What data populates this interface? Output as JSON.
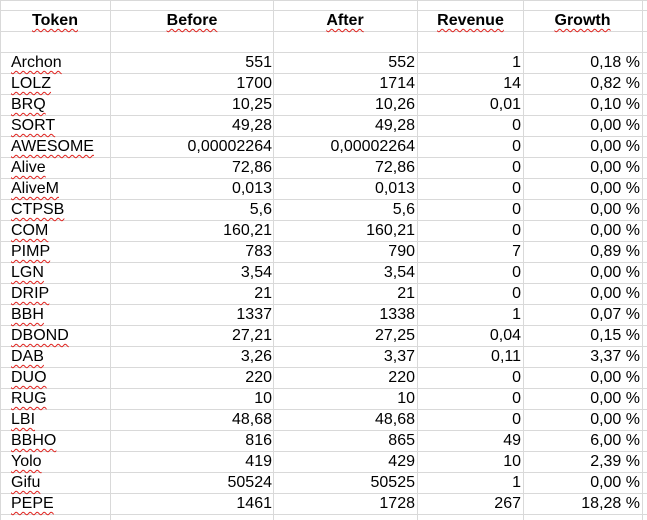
{
  "headers": {
    "token": "Token",
    "before": "Before",
    "after": "After",
    "revenue": "Revenue",
    "growth": "Growth"
  },
  "rows": [
    {
      "token": "Archon",
      "before": "551",
      "after": "552",
      "revenue": "1",
      "growth": "0,18 %"
    },
    {
      "token": "LOLZ",
      "before": "1700",
      "after": "1714",
      "revenue": "14",
      "growth": "0,82 %"
    },
    {
      "token": "BRQ",
      "before": "10,25",
      "after": "10,26",
      "revenue": "0,01",
      "growth": "0,10 %"
    },
    {
      "token": "SORT",
      "before": "49,28",
      "after": "49,28",
      "revenue": "0",
      "growth": "0,00 %"
    },
    {
      "token": "AWESOME",
      "before": "0,00002264",
      "after": "0,00002264",
      "revenue": "0",
      "growth": "0,00 %"
    },
    {
      "token": "Alive",
      "before": "72,86",
      "after": "72,86",
      "revenue": "0",
      "growth": "0,00 %"
    },
    {
      "token": "AliveM",
      "before": "0,013",
      "after": "0,013",
      "revenue": "0",
      "growth": "0,00 %"
    },
    {
      "token": "CTPSB",
      "before": "5,6",
      "after": "5,6",
      "revenue": "0",
      "growth": "0,00 %"
    },
    {
      "token": "COM",
      "before": "160,21",
      "after": "160,21",
      "revenue": "0",
      "growth": "0,00 %"
    },
    {
      "token": "PIMP",
      "before": "783",
      "after": "790",
      "revenue": "7",
      "growth": "0,89 %"
    },
    {
      "token": "LGN",
      "before": "3,54",
      "after": "3,54",
      "revenue": "0",
      "growth": "0,00 %"
    },
    {
      "token": "DRIP",
      "before": "21",
      "after": "21",
      "revenue": "0",
      "growth": "0,00 %"
    },
    {
      "token": "BBH",
      "before": "1337",
      "after": "1338",
      "revenue": "1",
      "growth": "0,07 %"
    },
    {
      "token": "DBOND",
      "before": "27,21",
      "after": "27,25",
      "revenue": "0,04",
      "growth": "0,15 %"
    },
    {
      "token": "DAB",
      "before": "3,26",
      "after": "3,37",
      "revenue": "0,11",
      "growth": "3,37 %"
    },
    {
      "token": "DUO",
      "before": "220",
      "after": "220",
      "revenue": "0",
      "growth": "0,00 %"
    },
    {
      "token": "RUG",
      "before": "10",
      "after": "10",
      "revenue": "0",
      "growth": "0,00 %"
    },
    {
      "token": "LBI",
      "before": "48,68",
      "after": "48,68",
      "revenue": "0",
      "growth": "0,00 %"
    },
    {
      "token": "BBHO",
      "before": "816",
      "after": "865",
      "revenue": "49",
      "growth": "6,00 %"
    },
    {
      "token": "Yolo",
      "before": "419",
      "after": "429",
      "revenue": "10",
      "growth": "2,39 %"
    },
    {
      "token": "Gifu",
      "before": "50524",
      "after": "50525",
      "revenue": "1",
      "growth": "0,00 %"
    },
    {
      "token": "PEPE",
      "before": "1461",
      "after": "1728",
      "revenue": "267",
      "growth": "18,28 %"
    }
  ],
  "colors": {
    "grid": "#d9d9d9",
    "spellcheck_underline": "#e0201b",
    "text": "#000000"
  }
}
